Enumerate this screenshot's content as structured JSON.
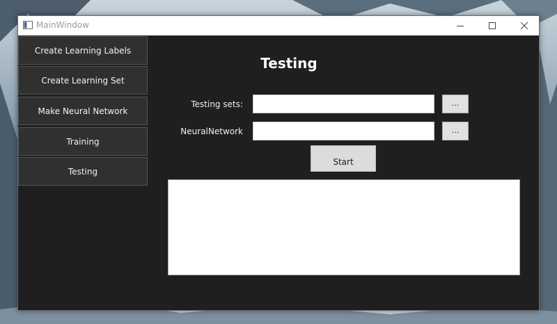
{
  "window": {
    "title": "MainWindow"
  },
  "nav": {
    "items": [
      {
        "label": "Create Learning Labels"
      },
      {
        "label": "Create Learning Set"
      },
      {
        "label": "Make Neural Network"
      },
      {
        "label": "Training"
      },
      {
        "label": "Testing"
      }
    ]
  },
  "main": {
    "heading": "Testing",
    "testing_sets": {
      "label": "Testing sets:",
      "value": "",
      "browse_label": "..."
    },
    "neural_network": {
      "label": "NeuralNetwork",
      "value": "",
      "browse_label": "..."
    },
    "start_label": "Start",
    "output_text": ""
  },
  "icons": {
    "app": "window-icon",
    "minimize": "minimize-icon",
    "maximize": "maximize-icon",
    "close": "close-icon"
  },
  "colors": {
    "window_background": "#1f1e20",
    "nav_button": "#303030",
    "titlebar": "#ffffff"
  }
}
